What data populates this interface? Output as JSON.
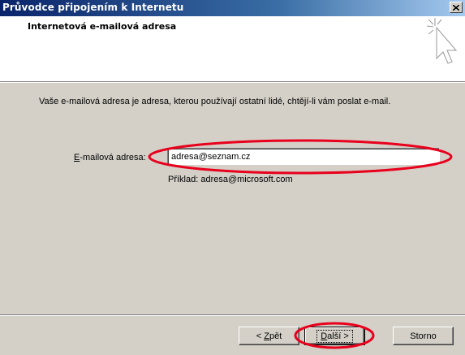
{
  "window": {
    "title": "Průvodce připojením k Internetu",
    "close_glyph": "×"
  },
  "header": {
    "title": "Internetová e-mailová adresa",
    "icon": "wizard-sparkle-cursor-icon"
  },
  "body": {
    "description": "Vaše e-mailová adresa je adresa, kterou používají ostatní lidé, chtějí-li vám poslat e-mail.",
    "email_label_accel": "E",
    "email_label_rest": "-mailová adresa:",
    "email_value": "adresa@seznam.cz",
    "example": "Příklad: adresa@microsoft.com"
  },
  "buttons": {
    "back_prefix": "< ",
    "back_accel": "Z",
    "back_rest": "pět",
    "next_accel": "D",
    "next_rest": "alší >",
    "cancel_label": "Storno"
  },
  "annotation_color": "#e8001c",
  "colors": {
    "dialog_bg": "#d4d0c8",
    "titlebar_start": "#0a246a",
    "titlebar_end": "#a6caf0",
    "header_bg": "#ffffff"
  }
}
